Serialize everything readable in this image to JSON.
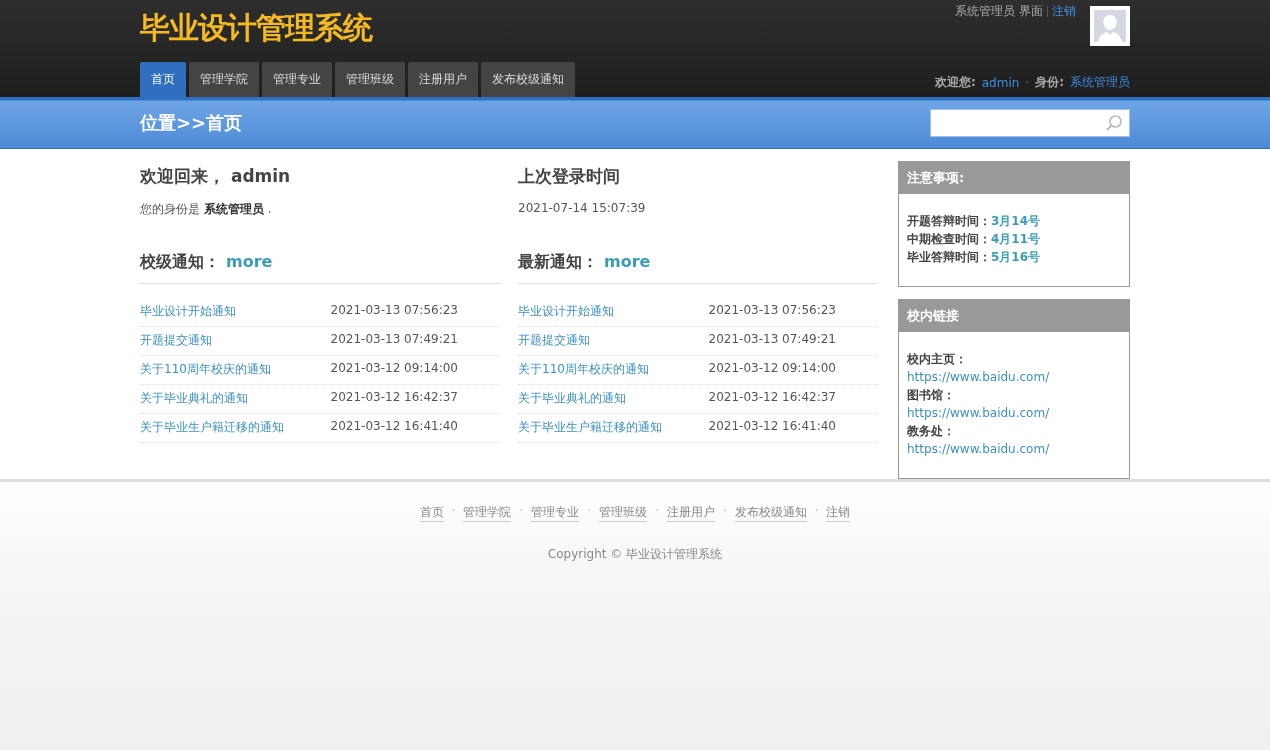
{
  "site_title": "毕业设计管理系统",
  "user_bar": {
    "role_text": "系统管理员 界面",
    "logout": "注销"
  },
  "nav": [
    {
      "label": "首页",
      "selected": true
    },
    {
      "label": "管理学院",
      "selected": false
    },
    {
      "label": "管理专业",
      "selected": false
    },
    {
      "label": "管理班级",
      "selected": false
    },
    {
      "label": "注册用户",
      "selected": false
    },
    {
      "label": "发布校级通知",
      "selected": false
    }
  ],
  "welcome_bar": {
    "welcome_label": "欢迎您:",
    "username": "admin",
    "separator": "·",
    "role_label": "身份:",
    "role": "系统管理员"
  },
  "breadcrumb": "位置>>首页",
  "welcome": {
    "title": "欢迎回来， admin",
    "identity": "您的身份是 **系统管理员** ."
  },
  "last_login": {
    "title": "上次登录时间",
    "time": "2021-07-14 15:07:39"
  },
  "notice_lists": [
    {
      "title": "校级通知：",
      "more": "more",
      "items": [
        {
          "title": "毕业设计开始通知",
          "time": "2021-03-13 07:56:23"
        },
        {
          "title": "开题提交通知",
          "time": "2021-03-13 07:49:21"
        },
        {
          "title": "关于110周年校庆的通知",
          "time": "2021-03-12 09:14:00"
        },
        {
          "title": "关于毕业典礼的通知",
          "time": "2021-03-12 16:42:37"
        },
        {
          "title": "关于毕业生户籍迁移的通知",
          "time": "2021-03-12 16:41:40"
        }
      ]
    },
    {
      "title": "最新通知：",
      "more": "more",
      "items": [
        {
          "title": "毕业设计开始通知",
          "time": "2021-03-13 07:56:23"
        },
        {
          "title": "开题提交通知",
          "time": "2021-03-13 07:49:21"
        },
        {
          "title": "关于110周年校庆的通知",
          "time": "2021-03-12 09:14:00"
        },
        {
          "title": "关于毕业典礼的通知",
          "time": "2021-03-12 16:42:37"
        },
        {
          "title": "关于毕业生户籍迁移的通知",
          "time": "2021-03-12 16:41:40"
        }
      ]
    }
  ],
  "notes_panel": {
    "title": "注意事项:",
    "items": [
      {
        "label": "开题答辩时间：",
        "value": "3月14号"
      },
      {
        "label": "中期检查时间：",
        "value": "4月11号"
      },
      {
        "label": "毕业答辩时间：",
        "value": "5月16号"
      }
    ]
  },
  "links_panel": {
    "title": "校内链接",
    "items": [
      {
        "label": "校内主页：",
        "url": "https://www.baidu.com/"
      },
      {
        "label": "图书馆：",
        "url": "https://www.baidu.com/"
      },
      {
        "label": "教务处：",
        "url": "https://www.baidu.com/"
      }
    ]
  },
  "footer": {
    "separator": "·",
    "links": [
      "首页",
      "管理学院",
      "管理专业",
      "管理班级",
      "注册用户",
      "发布校级通知",
      "注销"
    ],
    "copyright": "Copyright © 毕业设计管理系统"
  }
}
